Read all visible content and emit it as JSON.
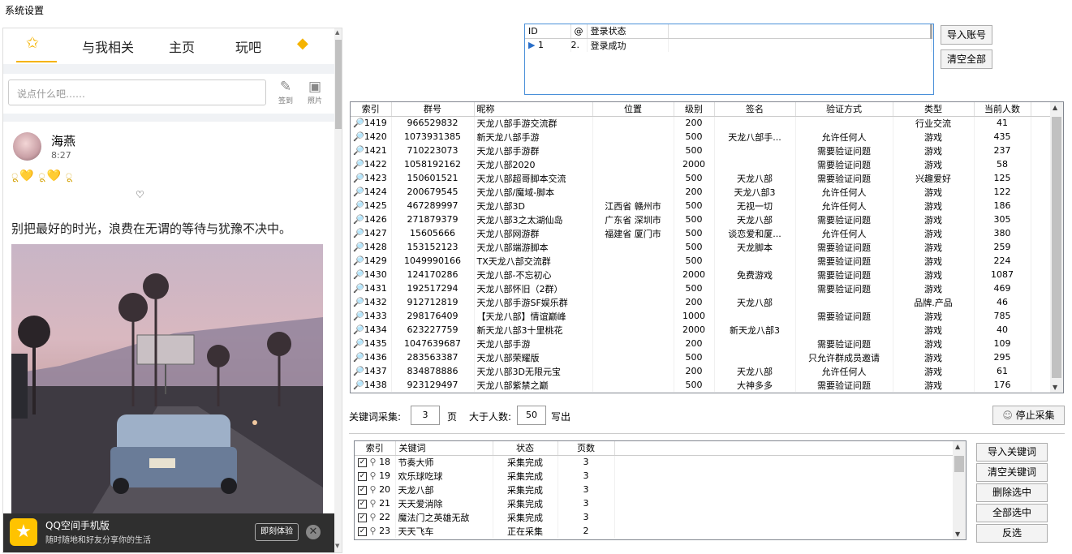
{
  "window_title": "系统设置",
  "qzone": {
    "tabs": [
      "与我相关",
      "主页",
      "玩吧"
    ],
    "say_placeholder": "说点什么吧……",
    "sign_label": "签到",
    "photo_label": "照片",
    "user_name": "海燕",
    "post_time": "8:27",
    "emoji_line": "ू💛 ू💛 ू",
    "heart": "♡",
    "post_text": "别把最好的时光，浪费在无谓的等待与犹豫不决中。",
    "banner_title": "QQ空间手机版",
    "banner_sub": "随时随地和好友分享你的生活",
    "banner_button": "即刻体验",
    "banner_close": "✕",
    "accent_color": "#ffc300"
  },
  "login_grid": {
    "headers": [
      "ID",
      "@",
      "登录状态"
    ],
    "rows": [
      {
        "id": "1",
        "qq": "2.",
        "status": "登录成功"
      }
    ]
  },
  "buttons": {
    "import_account": "导入账号",
    "clear_all": "清空全部",
    "stop_collect": "停止采集",
    "import_keywords": "导入关键词",
    "clear_keywords": "清空关键词",
    "delete_selected": "删除选中",
    "select_all": "全部选中",
    "invert": "反选"
  },
  "group_grid": {
    "headers": [
      "索引",
      "群号",
      "昵称",
      "位置",
      "级别",
      "签名",
      "验证方式",
      "类型",
      "当前人数"
    ],
    "rows": [
      [
        "1419",
        "966529832",
        "天龙八部手游交流群",
        "",
        "200",
        "",
        "",
        "行业交流",
        "41"
      ],
      [
        "1420",
        "1073931385",
        "新天龙八部手游",
        "",
        "500",
        "天龙八部手...",
        "允许任何人",
        "游戏",
        "435"
      ],
      [
        "1421",
        "710223073",
        "天龙八部手游群",
        "",
        "500",
        "",
        "需要验证问题",
        "游戏",
        "237"
      ],
      [
        "1422",
        "1058192162",
        "天龙八部2020",
        "",
        "2000",
        "",
        "需要验证问题",
        "游戏",
        "58"
      ],
      [
        "1423",
        "150601521",
        "天龙八部超哥脚本交流",
        "",
        "500",
        "天龙八部",
        "需要验证问题",
        "兴趣爱好",
        "125"
      ],
      [
        "1424",
        "200679545",
        "天龙八部/魔域-脚本",
        "",
        "200",
        "天龙八部3",
        "允许任何人",
        "游戏",
        "122"
      ],
      [
        "1425",
        "467289997",
        "天龙八部3D",
        "江西省 赣州市",
        "500",
        "无视一切",
        "允许任何人",
        "游戏",
        "186"
      ],
      [
        "1426",
        "271879379",
        "天龙八部3之太湖仙岛",
        "广东省 深圳市",
        "500",
        "天龙八部",
        "需要验证问题",
        "游戏",
        "305"
      ],
      [
        "1427",
        "15605666",
        "天龙八部网游群",
        "福建省 厦门市",
        "500",
        "谈恋爱和厦...",
        "允许任何人",
        "游戏",
        "380"
      ],
      [
        "1428",
        "153152123",
        "天龙八部端游脚本",
        "",
        "500",
        "天龙脚本",
        "需要验证问题",
        "游戏",
        "259"
      ],
      [
        "1429",
        "1049990166",
        "TX天龙八部交流群",
        "",
        "500",
        "",
        "需要验证问题",
        "游戏",
        "224"
      ],
      [
        "1430",
        "124170286",
        "天龙八部-不忘初心",
        "",
        "2000",
        "免费游戏",
        "需要验证问题",
        "游戏",
        "1087"
      ],
      [
        "1431",
        "192517294",
        "天龙八部怀旧（2群）",
        "",
        "500",
        "",
        "需要验证问题",
        "游戏",
        "469"
      ],
      [
        "1432",
        "912712819",
        "天龙八部手游SF娱乐群",
        "",
        "200",
        "天龙八部",
        "",
        "品牌.产品",
        "46"
      ],
      [
        "1433",
        "298176409",
        "【天龙八部】情谊巅峰",
        "",
        "1000",
        "",
        "需要验证问题",
        "游戏",
        "785"
      ],
      [
        "1434",
        "623227759",
        "新天龙八部3十里桃花",
        "",
        "2000",
        "新天龙八部3",
        "",
        "游戏",
        "40"
      ],
      [
        "1435",
        "1047639687",
        "天龙八部手游",
        "",
        "200",
        "",
        "需要验证问题",
        "游戏",
        "109"
      ],
      [
        "1436",
        "283563387",
        "天龙八部荣耀版",
        "",
        "500",
        "",
        "只允许群成员邀请",
        "游戏",
        "295"
      ],
      [
        "1437",
        "834878886",
        "天龙八部3D无限元宝",
        "",
        "200",
        "天龙八部",
        "允许任何人",
        "游戏",
        "61"
      ],
      [
        "1438",
        "923129497",
        "天龙八部紫禁之巅",
        "",
        "500",
        "大神多多",
        "需要验证问题",
        "游戏",
        "176"
      ]
    ]
  },
  "controls": {
    "keyword_collect_label": "关键词采集:",
    "pages_value": "3",
    "pages_unit": "页",
    "min_members_label": "大于人数:",
    "min_members_value": "50",
    "write_label": "写出"
  },
  "keyword_grid": {
    "headers": [
      "索引",
      "关键词",
      "状态",
      "页数"
    ],
    "rows": [
      [
        "18",
        "节奏大师",
        "采集完成",
        "3"
      ],
      [
        "19",
        "欢乐球吃球",
        "采集完成",
        "3"
      ],
      [
        "20",
        "天龙八部",
        "采集完成",
        "3"
      ],
      [
        "21",
        "天天爱消除",
        "采集完成",
        "3"
      ],
      [
        "22",
        "魔法门之英雄无敌",
        "采集完成",
        "3"
      ],
      [
        "23",
        "天天飞车",
        "正在采集",
        "2"
      ]
    ]
  }
}
